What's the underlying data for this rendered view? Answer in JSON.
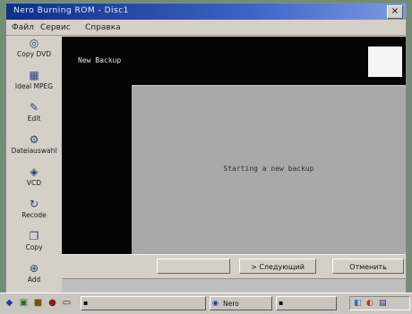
{
  "window": {
    "title": "Nero Burning ROM - Disc1"
  },
  "menu": {
    "items": [
      "Файл",
      "Сервис",
      "Справка"
    ]
  },
  "sidebar": {
    "items": [
      {
        "label": "Copy DVD",
        "icon": "disc-icon"
      },
      {
        "label": "Ideal MPEG",
        "icon": "film-icon"
      },
      {
        "label": "Edit",
        "icon": "edit-icon"
      },
      {
        "label": "Dateiauswahl",
        "icon": "gear-icon"
      },
      {
        "label": "VCD",
        "icon": "vcd-icon"
      },
      {
        "label": "Recode",
        "icon": "recode-icon"
      },
      {
        "label": "Copy",
        "icon": "copy-icon"
      },
      {
        "label": "Add",
        "icon": "add-icon"
      }
    ]
  },
  "wizard": {
    "title": "New Backup",
    "status": "Starting a new backup"
  },
  "buttons": {
    "back": "",
    "next": "> Следующий",
    "cancel": "Отменить"
  },
  "log": {
    "lines": [
      "  ",
      "  "
    ]
  },
  "taskbar": {
    "tasks": [
      {
        "label": ""
      },
      {
        "label": "Nero"
      }
    ],
    "clock": "",
    "colors": {
      "accent": "#1c3e9c"
    }
  }
}
